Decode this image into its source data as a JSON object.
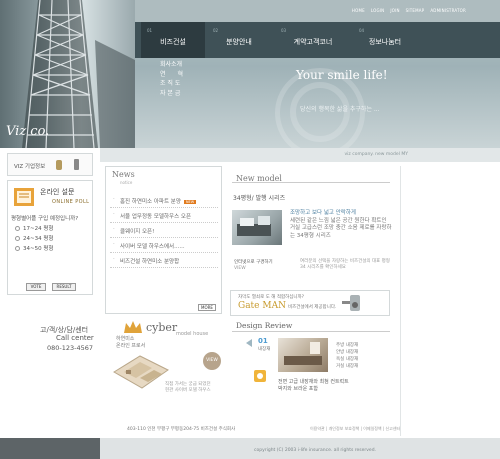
{
  "header": {
    "util_links": [
      "HOME",
      "LOGIN",
      "JOIN",
      "SITEMAP",
      "ADMINISTRATOR"
    ],
    "nav": [
      {
        "num": "01",
        "label": "비즈건설"
      },
      {
        "num": "02",
        "label": "분양안내"
      },
      {
        "num": "03",
        "label": "계약고객코너"
      },
      {
        "num": "04",
        "label": "정보나눔터"
      }
    ],
    "submenu": [
      "회사소개",
      "연　　혁",
      "조 직 도",
      "자 본 금"
    ],
    "hero_title": "Your smile life!",
    "hero_sub": "당신의 행복한 삶을 추구하는 ...",
    "logo": "Viz co."
  },
  "crumb": "viz company. new model MY",
  "left": {
    "viz_label": "VIZ 기업정보",
    "poll": {
      "title": "온라인 설문",
      "subtitle": "ONLINE POLL",
      "question": "평형별어플 구입 예정입니까?",
      "options": [
        "17~24 평형",
        "24~34 평형",
        "34~50 평형"
      ],
      "vote_label": "VOTE",
      "result_label": "RESULT"
    },
    "call": {
      "ko": "고/객/상/담/센터",
      "en": "Call center",
      "phone": "080-123-4567"
    }
  },
  "news": {
    "title": "News",
    "subtitle": "notice",
    "items": [
      {
        "text": "홈진 하연미소 아파트 분양",
        "new": "NEW"
      },
      {
        "text": "서울 업무정동 모델하우스 오픈",
        "new": ""
      },
      {
        "text": "클웨이지 오픈!",
        "new": ""
      },
      {
        "text": "사이버 모델 하우스에서......",
        "new": ""
      },
      {
        "text": "비즈건설 하연미소 분양합",
        "new": ""
      }
    ],
    "more": "MORE"
  },
  "new_model": {
    "title": "New model",
    "label": "34평형/ 발행 시리즈",
    "desc_highlight": "조망하고 보다 넓고 안락하게",
    "desc": "세련된 같은 느낌 넓은 공간 원한다 확트인 거실 고급스런 조망 충간 소음 제로를 자랑하는 34평형 시리즈",
    "cta": "인터넷으로 구경하기",
    "cta_sub": "VIEW",
    "desc2": "여러분의 선택을 자랑하는 비즈건설의 대표 평형 34 시리즈를 확인하세요"
  },
  "gate": {
    "top": "자막도 열쇠로 도 해 적합하십니까?",
    "name": "Gate MAN",
    "note": "비즈건설에서 제공합니다."
  },
  "cyber": {
    "title": "cyber",
    "subtitle": "model house",
    "desc": "하연미소\n온라인 프로서",
    "view": "VIEW",
    "note": "직접 가서는 궁금 되었던\n현관 사이버 모델 하우스"
  },
  "design_review": {
    "title": "Design Review",
    "num": "01",
    "num_sub": "내장재",
    "list": [
      "주방 내장재",
      "안방 내장재",
      "욕실 내장재",
      "거실 내장재"
    ],
    "caption": "전면 고급 내장재와 최첨 컨트럭트\n박지와 브라운 포함"
  },
  "footer": {
    "address": "403-110 인천 부평구 부평동204-75 비즈건설 주식회사",
    "links": "이용약관 | 개인정보 보호정책 | 이메일정책 | 신고센터",
    "copyright": "copyright (C) 2003 i-life insurance. all rights reserved."
  },
  "colors": {
    "nav_bg": "#3f5157",
    "accent": "#e07a1e",
    "gate_gold": "#c79a2c"
  }
}
